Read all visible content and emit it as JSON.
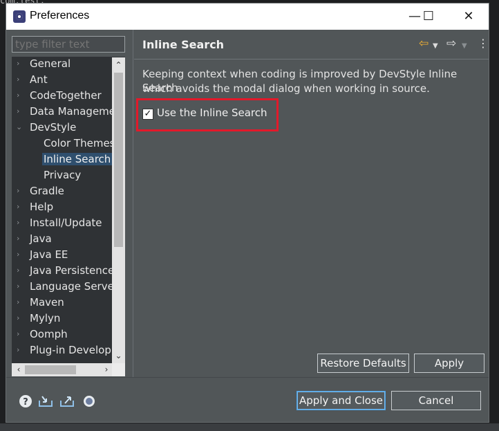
{
  "window": {
    "title": "Preferences",
    "minimize": "—",
    "maximize": "☐",
    "close": "✕"
  },
  "background": {
    "code_line": "com.test;"
  },
  "filter": {
    "placeholder": "type filter text"
  },
  "tree": {
    "items": [
      {
        "label": "General",
        "expanded": false
      },
      {
        "label": "Ant",
        "expanded": false
      },
      {
        "label": "CodeTogether",
        "expanded": false
      },
      {
        "label": "Data Manageme",
        "expanded": false
      },
      {
        "label": "DevStyle",
        "expanded": true
      },
      {
        "label": "Color Themes",
        "child": true
      },
      {
        "label": "Inline Search",
        "child": true,
        "selected": true
      },
      {
        "label": "Privacy",
        "child": true
      },
      {
        "label": "Gradle",
        "expanded": false
      },
      {
        "label": "Help",
        "expanded": false
      },
      {
        "label": "Install/Update",
        "expanded": false
      },
      {
        "label": "Java",
        "expanded": false
      },
      {
        "label": "Java EE",
        "expanded": false
      },
      {
        "label": "Java Persistence",
        "expanded": false
      },
      {
        "label": "Language Server",
        "expanded": false
      },
      {
        "label": "Maven",
        "expanded": false
      },
      {
        "label": "Mylyn",
        "expanded": false
      },
      {
        "label": "Oomph",
        "expanded": false
      },
      {
        "label": "Plug-in Developr",
        "expanded": false
      }
    ]
  },
  "page": {
    "title": "Inline Search",
    "description_line1": "Keeping context when coding is improved by DevStyle Inline Search",
    "description_line2": "which avoids the modal dialog when working in source.",
    "checkbox_label": "Use the Inline Search",
    "checkbox_checked": true
  },
  "buttons": {
    "restore_defaults": "Restore Defaults",
    "apply": "Apply",
    "apply_and_close": "Apply and Close",
    "cancel": "Cancel"
  },
  "colors": {
    "highlight": "#e3192a",
    "selection": "#2f4f6e",
    "dialog": "#515658",
    "nav_back": "#f2b233"
  },
  "icons": [
    "help-icon",
    "import-icon",
    "export-icon",
    "oomph-icon",
    "back-icon",
    "forward-icon",
    "view-menu-icon"
  ]
}
